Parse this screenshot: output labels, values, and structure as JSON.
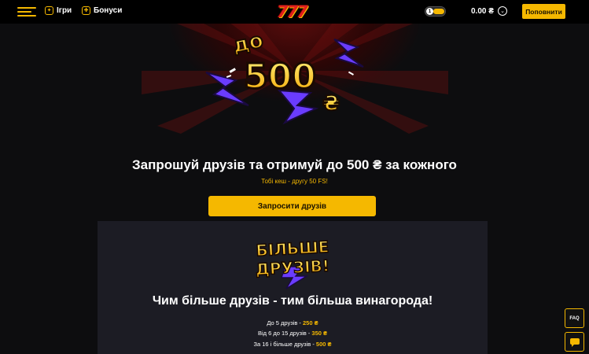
{
  "header": {
    "nav_games": "Ігри",
    "nav_bonuses": "Бонуси",
    "logo": "777",
    "toggle_label": "1",
    "balance": "0.00 ₴",
    "deposit_label": "Поповнити"
  },
  "hero": {
    "badge_prefix": "до",
    "badge_amount": "500",
    "badge_currency": "₴",
    "title": "Запрошуй друзів та отримуй до 500 ₴ за кожного",
    "subtitle": "Тобі кеш - другу 50 FS!",
    "invite_label": "Запросити друзів"
  },
  "card": {
    "logo_line1": "БІЛЬШЕ",
    "logo_line2": "ДРУЗІВ!",
    "title": "Чим більше друзів - тим більша винагорода!",
    "tiers": [
      {
        "label": "До 5 друзів - ",
        "value": "250 ₴"
      },
      {
        "label": "Від 6 до 15 друзів - ",
        "value": "350 ₴"
      },
      {
        "label": "За 16 і більше друзів - ",
        "value": "500 ₴"
      }
    ]
  },
  "side": {
    "faq_label": "FAQ"
  },
  "colors": {
    "accent": "#f5b800",
    "background": "#0d0d0f",
    "card": "#1c1c24",
    "purple": "#6a3cff"
  },
  "icons": [
    "menu-icon",
    "games-icon",
    "bonuses-icon",
    "chevron-down-icon",
    "chat-icon",
    "lightning-icon"
  ]
}
